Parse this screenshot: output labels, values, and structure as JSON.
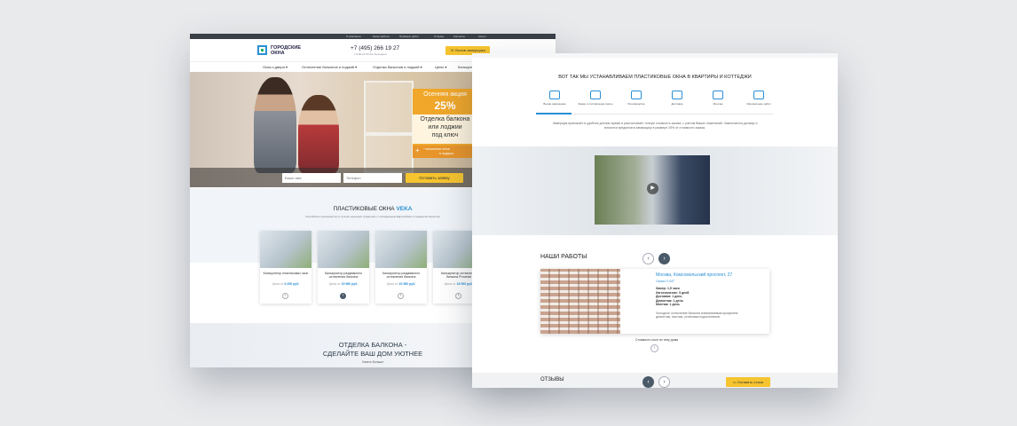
{
  "left_page": {
    "topbar_links": [
      "О компании",
      "Наши работы",
      "Примеры работ",
      "Отзывы",
      "Контакты",
      "Акции"
    ],
    "logo": {
      "line1": "ГОРОДСКИЕ",
      "line2": "ОКНА"
    },
    "phone": "+7 (495) 266 19 27",
    "phone_sub": "с 9:00-21:00 без выходных",
    "callback_button": "Вызов замерщика",
    "nav_items": [
      "Окна и двери ▾",
      "Остекление балконов и лоджий ▾",
      "Отделка балконов и лоджий ▾",
      "Цены ▾",
      "Калькулятор"
    ],
    "promo": {
      "line1": "Осенняя акция",
      "percent": "25%",
      "offer1": "Отделка балкона",
      "offer2": "или лоджии",
      "offer3": "под ключ",
      "note1": "+ москитная сетка",
      "note2": "в подарок"
    },
    "form": {
      "name_placeholder": "Ваше имя",
      "phone_placeholder": "Телефон",
      "submit": "Оставить заявку"
    },
    "veka": {
      "title_prefix": "ПЛАСТИКОВЫЕ ОКНА",
      "title_brand": "VEKA",
      "subtitle": "Российское производство в лучших немецких традициях с соблюдением Европейских Стандартов Качества"
    },
    "cards": [
      {
        "name": "Калькулятор пластиковых окон",
        "price_label": "Цена от",
        "price": "6 490 руб."
      },
      {
        "name": "Калькулятор раздвижного остекления балкона",
        "price_label": "Цена от",
        "price": "15 980 руб."
      },
      {
        "name": "Калькулятор раздвижного остекления балкона",
        "price_label": "Цена от",
        "price": "20 980 руб."
      },
      {
        "name": "Калькулятор остекления балкона Provedal",
        "price_label": "Цена от",
        "price": "18 590 руб."
      }
    ],
    "balcony": {
      "line1": "ОТДЕЛКА БАЛКОНА -",
      "line2": "СДЕЛАЙТЕ ВАШ ДОМ УЮТНЕЕ",
      "link": "Узнать больше"
    }
  },
  "right_page": {
    "heading": "ВОТ ТАК МЫ УСТАНАВЛИВАЕМ ПЛАСТИКОВЫЕ ОКНА В КВАРТИРЫ И КОТТЕДЖИ",
    "steps": [
      {
        "label": "Вызов замерщика"
      },
      {
        "label": "Замер и составление сметы"
      },
      {
        "label": "Производство"
      },
      {
        "label": "Доставка"
      },
      {
        "label": "Монтаж"
      },
      {
        "label": "Оформление работ"
      }
    ],
    "step_text": "Замерщик приезжает в удобное для вас время и рассчитывает точную стоимость заказа, с учетом Ваших пожеланий. Заключается договор и вносится предоплата замерщику в размере 25% от стоимости заказа.",
    "works_title": "НАШИ РАБОТЫ",
    "work": {
      "title": "Москва, Комсомольский проспект, 27",
      "series": "Серия П-44Т",
      "spec1": "Замер: 1,5 часа",
      "spec2": "Изготовление: 5 дней",
      "spec3": "Доставка: 1 день",
      "spec4": "Демонтаж: 1 день",
      "spec5": "Монтаж: 1 день",
      "desc": "Холодное остекление балкона алюминиевым профилем демонтаж, монтаж, установка подоконников."
    },
    "cost_link": "Стоимость окон по типу дома",
    "reviews_title": "ОТЗЫВЫ",
    "review_button": "Оставить отзыв"
  }
}
